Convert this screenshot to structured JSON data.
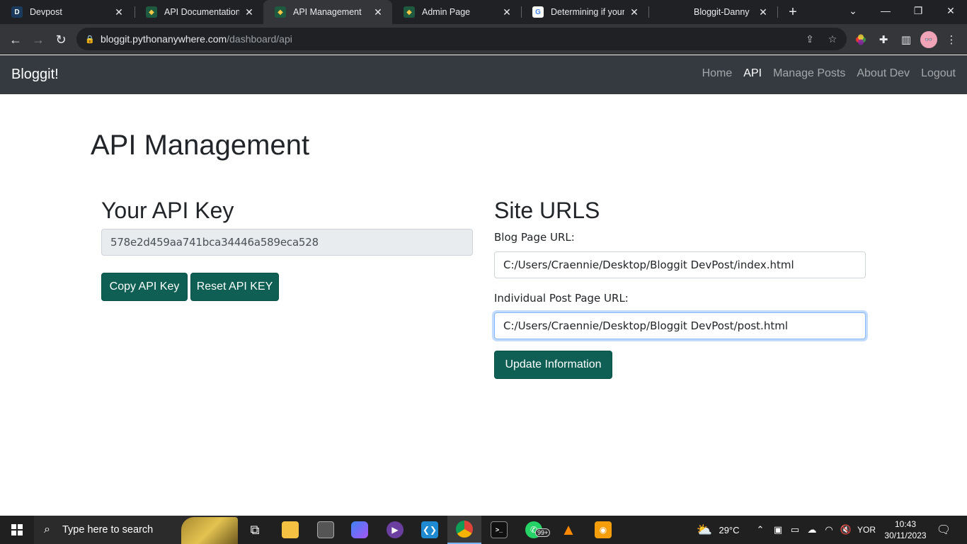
{
  "browser": {
    "tabs": [
      {
        "title": "Devpost",
        "favicon": "D"
      },
      {
        "title": "API Documentation",
        "favicon": "py"
      },
      {
        "title": "API Management",
        "favicon": "py"
      },
      {
        "title": "Admin Page",
        "favicon": "py"
      },
      {
        "title": "Determining if your c",
        "favicon": "G"
      },
      {
        "title": "Bloggit-Danny",
        "favicon": ""
      }
    ],
    "url_host": "bloggit.pythonanywhere.com",
    "url_path": "/dashboard/api"
  },
  "navbar": {
    "brand": "Bloggit!",
    "links": [
      {
        "label": "Home",
        "active": false
      },
      {
        "label": "API",
        "active": true
      },
      {
        "label": "Manage Posts",
        "active": false
      },
      {
        "label": "About Dev",
        "active": false
      },
      {
        "label": "Logout",
        "active": false
      }
    ]
  },
  "page": {
    "title": "API Management",
    "api_key_section": {
      "heading": "Your API Key",
      "api_key": "578e2d459aa741bca34446a589eca528",
      "copy_button": "Copy API Key",
      "reset_button": "Reset API KEY"
    },
    "site_urls_section": {
      "heading": "Site URLS",
      "blog_url_label": "Blog Page URL:",
      "blog_url_value": "C:/Users/Craennie/Desktop/Bloggit DevPost/index.html",
      "post_url_label": "Individual Post Page URL:",
      "post_url_value": "C:/Users/Craennie/Desktop/Bloggit DevPost/post.html",
      "update_button": "Update Information"
    }
  },
  "taskbar": {
    "search_placeholder": "Type here to search",
    "whatsapp_badge": "99+",
    "weather": "29°C",
    "language": "YOR",
    "time": "10:43",
    "date": "30/11/2023"
  },
  "colors": {
    "navbar_bg": "#343a40",
    "button_bg": "#0f5f54",
    "browser_dark": "#202124",
    "taskbar_bg": "#202020"
  }
}
